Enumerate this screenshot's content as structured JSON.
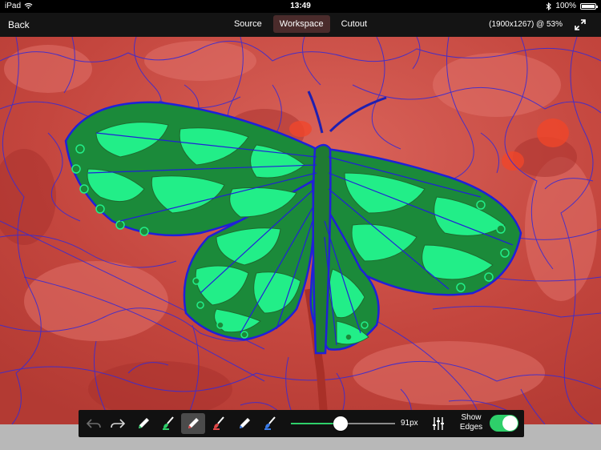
{
  "status_bar": {
    "device": "iPad",
    "time": "13:49",
    "battery": "100%",
    "battery_level": 1.0
  },
  "nav": {
    "back_label": "Back",
    "tabs": [
      "Source",
      "Workspace",
      "Cutout"
    ],
    "active_tab": "Workspace",
    "image_info": "(1900x1267) @  53%"
  },
  "toolbar": {
    "brush_size_label": "91px",
    "brush_size_fraction": 0.48,
    "show_edges_label": "Show Edges",
    "show_edges_on": true
  },
  "colors": {
    "accent": "#2ecf6a",
    "background_overlay": "#c9524a",
    "foreground_light": "#22ee88",
    "foreground_dark": "#1b8a3a",
    "edges": "#2a2ad0"
  },
  "icons": [
    "wifi-icon",
    "bluetooth-icon",
    "battery-icon",
    "expand-icon",
    "undo-icon",
    "redo-icon",
    "pencil-icon",
    "foreground-brush-icon",
    "eraser-icon",
    "background-brush-icon",
    "edge-pencil-icon",
    "edge-brush-icon",
    "adjust-sliders-icon"
  ]
}
